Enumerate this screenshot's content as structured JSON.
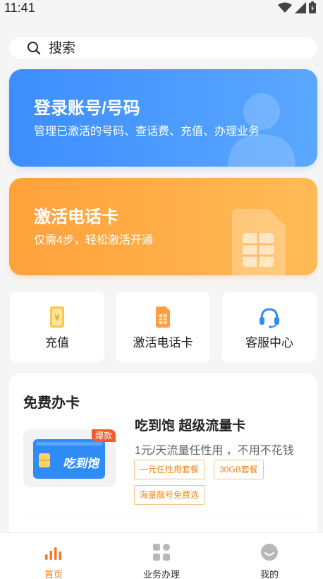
{
  "status_bar": {
    "time": "11:41"
  },
  "search": {
    "placeholder": "搜索"
  },
  "banners": {
    "login": {
      "title": "登录账号/号码",
      "subtitle": "管理已激活的号码、查话费、充值、办理业务"
    },
    "activate": {
      "title": "激活电话卡",
      "subtitle": "仅需4步，轻松激活开通"
    }
  },
  "quick_actions": [
    {
      "label": "充值",
      "icon": "recharge-icon"
    },
    {
      "label": "激活电话卡",
      "icon": "sim-card-icon"
    },
    {
      "label": "客服中心",
      "icon": "headset-icon"
    }
  ],
  "free_card": {
    "title": "免费办卡",
    "product": {
      "name": "吃到饱 超级流量卡",
      "description": "1元/天流量任性用 ，不用不花钱",
      "badge": "爆款",
      "card_text": "吃到饱",
      "tags": [
        "一元任性用套餐",
        "30GB套餐",
        "海量靓号免费选"
      ]
    }
  },
  "tabbar": [
    {
      "label": "首页",
      "icon": "home-bars-icon",
      "active": true
    },
    {
      "label": "业务办理",
      "icon": "grid-icon",
      "active": false
    },
    {
      "label": "我的",
      "icon": "profile-icon",
      "active": false
    }
  ],
  "colors": {
    "accent": "#f5781e",
    "login_card": "#3d8dfe",
    "activate_card": "#ffa13a"
  }
}
